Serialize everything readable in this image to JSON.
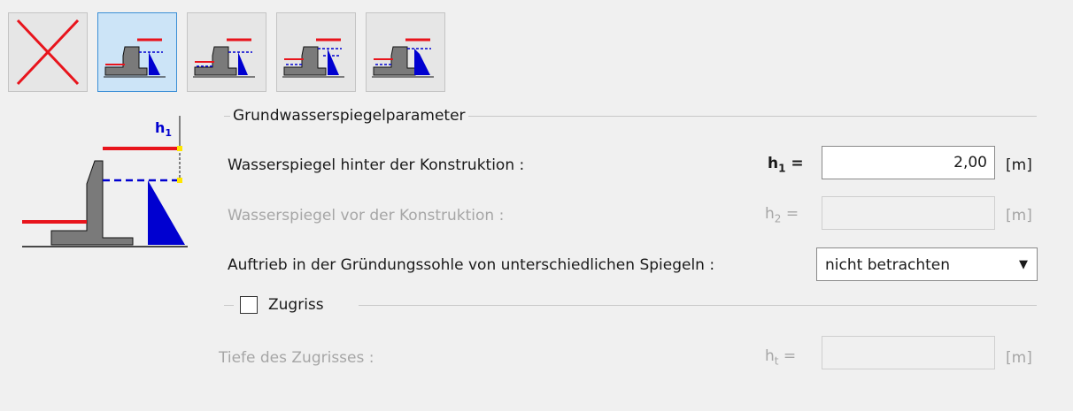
{
  "toolbar": {
    "buttons": [
      {
        "name": "close",
        "icon": "red-x-icon",
        "active": false
      },
      {
        "name": "water-option-1",
        "icon": "wall-water-option-1-icon",
        "active": true
      },
      {
        "name": "water-option-2",
        "icon": "wall-water-option-2-icon",
        "active": false
      },
      {
        "name": "water-option-3",
        "icon": "wall-water-option-3-icon",
        "active": false
      },
      {
        "name": "water-option-4",
        "icon": "wall-water-option-4-icon",
        "active": false
      }
    ]
  },
  "diagram": {
    "label_main": "h",
    "label_sub": "1"
  },
  "groundwater": {
    "title": "Grundwasserspiegelparameter",
    "behind_label": "Wasserspiegel hinter der Konstruktion :",
    "behind_sym": "h",
    "behind_sub": "1",
    "eq": "=",
    "behind_value": "2,00",
    "unit": "[m]",
    "front_label": "Wasserspiegel vor der Konstruktion :",
    "front_sym": "h",
    "front_sub": "2",
    "front_value": "",
    "uplift_label": "Auftrieb in der Gründungssohle von unterschiedlichen Spiegeln :",
    "uplift_value": "nicht betrachten"
  },
  "tension": {
    "title": "Zugriss",
    "checked": false,
    "depth_label": "Tiefe des Zugrisses :",
    "depth_sym": "h",
    "depth_sub": "t",
    "depth_value": ""
  },
  "colors": {
    "water_blue": "#0000d0",
    "level_red": "#e8141c",
    "wall_gray": "#7a7a7a",
    "active_bg": "#cce4f7"
  }
}
